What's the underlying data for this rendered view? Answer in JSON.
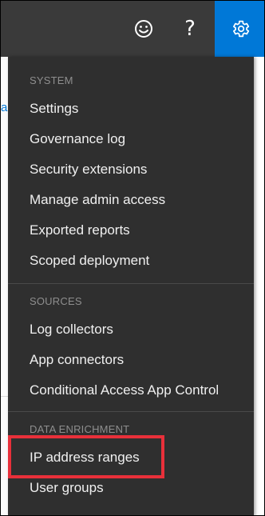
{
  "topbar": {
    "help_glyph": "?",
    "icons": [
      "smiley-icon",
      "help-icon",
      "gear-icon"
    ],
    "accent_color": "#0078d7"
  },
  "menu": {
    "sections": [
      {
        "label": "SYSTEM",
        "items": [
          "Settings",
          "Governance log",
          "Security extensions",
          "Manage admin access",
          "Exported reports",
          "Scoped deployment"
        ]
      },
      {
        "label": "SOURCES",
        "items": [
          "Log collectors",
          "App connectors",
          "Conditional Access App Control"
        ]
      },
      {
        "label": "DATA ENRICHMENT",
        "items": [
          "IP address ranges",
          "User groups"
        ]
      }
    ]
  },
  "background": {
    "link_fragment": "a"
  },
  "highlight_color": "#e8303a"
}
